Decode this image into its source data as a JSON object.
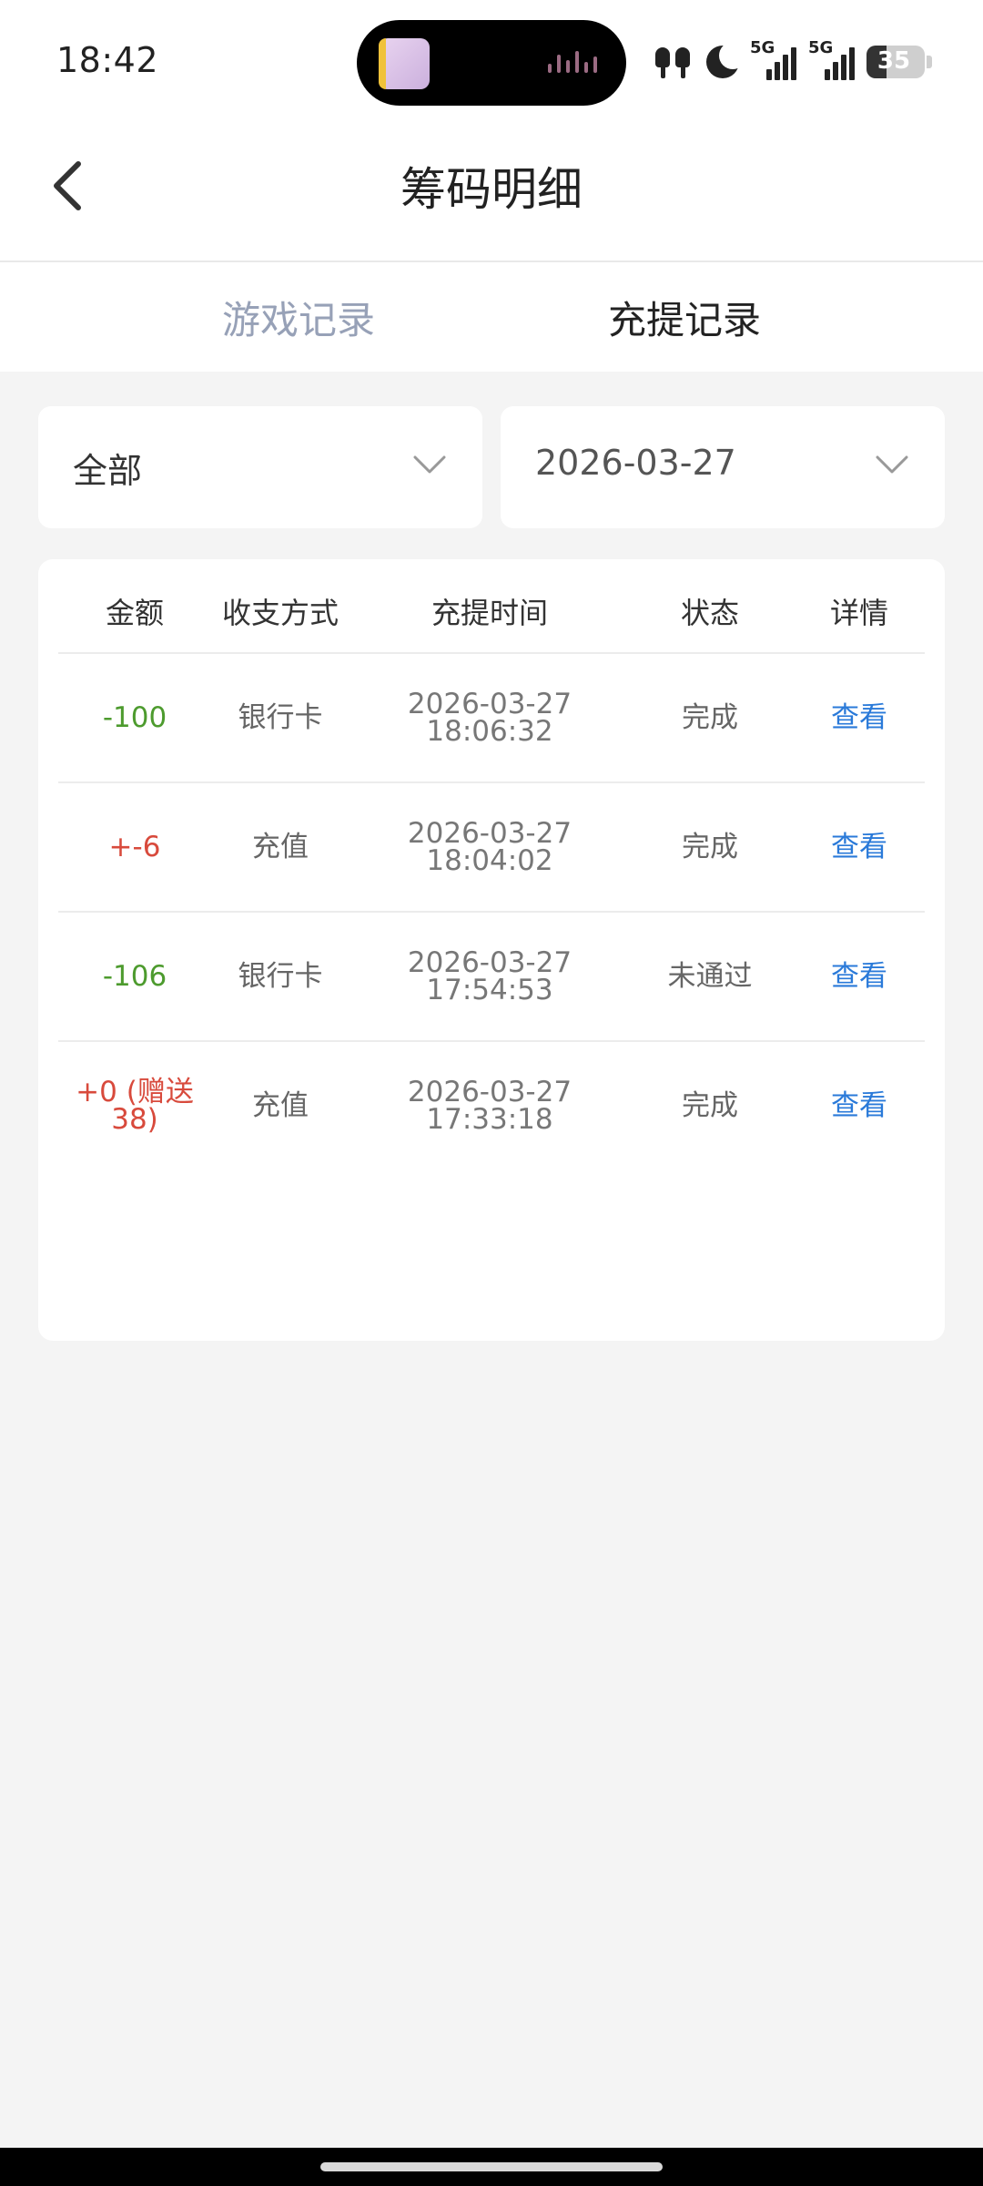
{
  "status_bar": {
    "time": "18:42",
    "network_1": "5G",
    "network_2": "5G",
    "battery": "35",
    "battery_level": 0.35
  },
  "header": {
    "title": "筹码明细"
  },
  "tabs": [
    {
      "label": "游戏记录",
      "active": false
    },
    {
      "label": "充提记录",
      "active": true
    }
  ],
  "filters": {
    "type": "全部",
    "date": "2026-03-27"
  },
  "table": {
    "columns": [
      "金额",
      "收支方式",
      "充提时间",
      "状态",
      "详情"
    ],
    "rows": [
      {
        "amount": "-100",
        "method": "银行卡",
        "date": "2026-03-27",
        "time": "18:06:32",
        "status": "完成",
        "detail": "查看",
        "sign": "neg"
      },
      {
        "amount": "+-6",
        "method": "充值",
        "date": "2026-03-27",
        "time": "18:04:02",
        "status": "完成",
        "detail": "查看",
        "sign": "pos"
      },
      {
        "amount": "-106",
        "method": "银行卡",
        "date": "2026-03-27",
        "time": "17:54:53",
        "status": "未通过",
        "detail": "查看",
        "sign": "neg"
      },
      {
        "amount": "+0 (赠送38)",
        "method": "充值",
        "date": "2026-03-27",
        "time": "17:33:18",
        "status": "完成",
        "detail": "查看",
        "sign": "pos"
      }
    ]
  },
  "colors": {
    "negative": "#4d9b2e",
    "positive": "#d84a3c",
    "link": "#2a7ad9",
    "inactive_tab": "#97a1b7",
    "background": "#f4f4f4"
  }
}
